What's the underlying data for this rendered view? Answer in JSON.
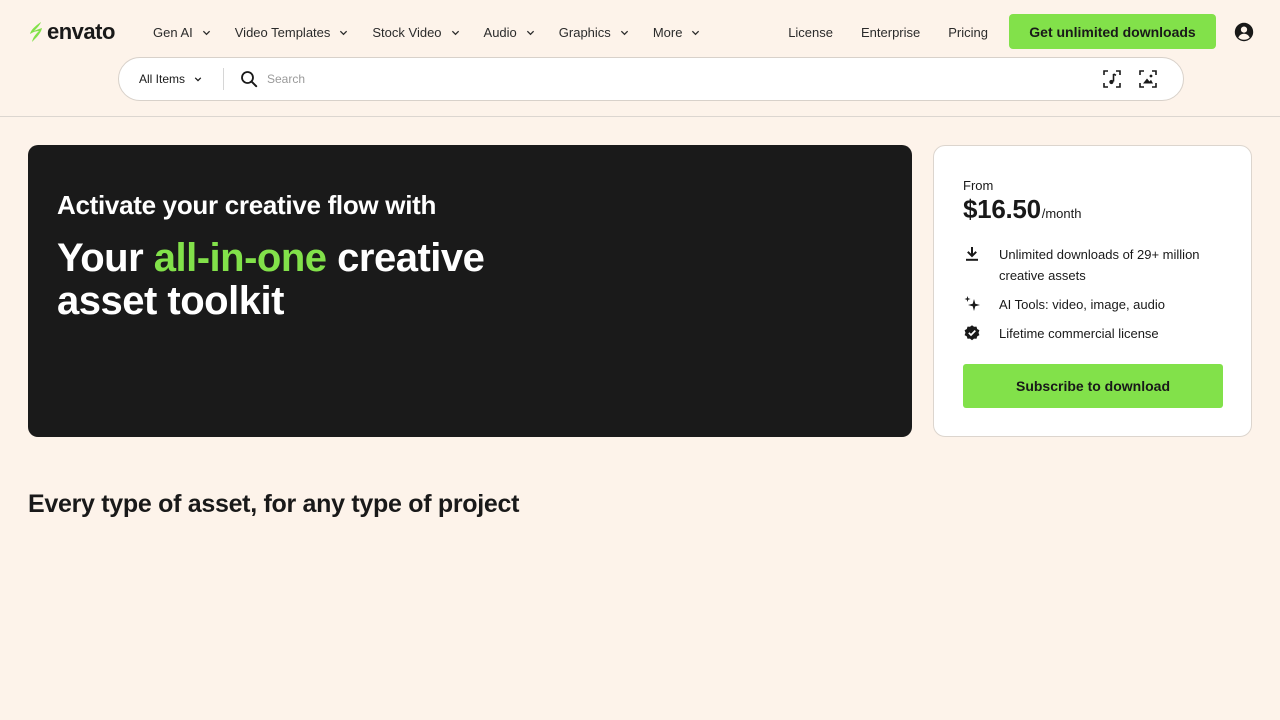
{
  "brand": {
    "name": "envato",
    "accent_color": "#82e14a",
    "background_color": "#fdf3ea",
    "hero_color": "#1a1a1a"
  },
  "nav": {
    "items": [
      {
        "label": "Gen AI",
        "icon": "chevron-down-icon"
      },
      {
        "label": "Video Templates",
        "icon": "chevron-down-icon"
      },
      {
        "label": "Stock Video",
        "icon": "chevron-down-icon"
      },
      {
        "label": "Audio",
        "icon": "chevron-down-icon"
      },
      {
        "label": "Graphics",
        "icon": "chevron-down-icon"
      },
      {
        "label": "More",
        "icon": "chevron-down-icon"
      }
    ],
    "links": [
      "License",
      "Enterprise",
      "Pricing"
    ],
    "cta_label": "Get unlimited downloads",
    "account_icon": "user-account-icon"
  },
  "search": {
    "filter_label": "All Items",
    "placeholder": "Search",
    "value": "",
    "tool_icons": [
      "music-search-icon",
      "image-search-icon"
    ]
  },
  "hero": {
    "kicker": "Activate your creative flow with",
    "title_part1": "Your ",
    "title_accent": "all-in-one",
    "title_part2": " creative asset toolkit"
  },
  "pricing": {
    "from_label": "From",
    "price": "$16.50",
    "period": "/month",
    "features": [
      {
        "icon": "download-icon",
        "text": "Unlimited downloads of 29+ million creative assets"
      },
      {
        "icon": "sparkles-icon",
        "text": "AI Tools: video, image, audio"
      },
      {
        "icon": "verified-badge-icon",
        "text": "Lifetime commercial license"
      }
    ],
    "button_label": "Subscribe to download"
  },
  "section": {
    "title": "Every type of asset, for any type of project"
  }
}
